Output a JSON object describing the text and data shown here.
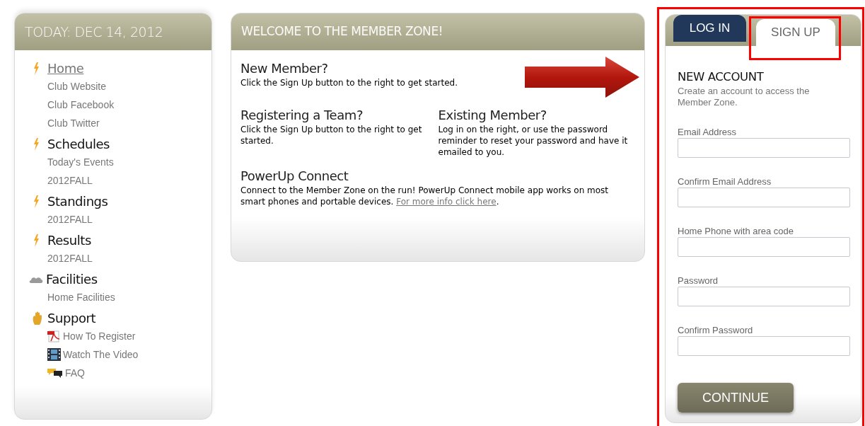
{
  "sidebar": {
    "title": "TODAY: DEC 14, 2012",
    "sections": [
      {
        "kind": "bolt",
        "label": "Home",
        "selected": true,
        "children": [
          {
            "label": "Club Website"
          },
          {
            "label": "Club Facebook"
          },
          {
            "label": "Club Twitter"
          }
        ]
      },
      {
        "kind": "bolt",
        "label": "Schedules",
        "selected": false,
        "children": [
          {
            "label": "Today's Events"
          },
          {
            "label": "2012FALL"
          }
        ]
      },
      {
        "kind": "bolt",
        "label": "Standings",
        "selected": false,
        "children": [
          {
            "label": "2012FALL"
          }
        ]
      },
      {
        "kind": "bolt",
        "label": "Results",
        "selected": false,
        "children": [
          {
            "label": "2012FALL"
          }
        ]
      },
      {
        "kind": "cloud",
        "label": "Facilities",
        "selected": false,
        "children": [
          {
            "label": "Home Facilities"
          }
        ]
      },
      {
        "kind": "hand",
        "label": "Support",
        "selected": false,
        "children": [
          {
            "label": "How To Register",
            "kind": "pdf"
          },
          {
            "label": "Watch The Video",
            "kind": "film"
          },
          {
            "label": "FAQ",
            "kind": "chat"
          }
        ]
      }
    ]
  },
  "welcome": {
    "title": "WELCOME TO THE MEMBER ZONE!",
    "new_member": {
      "heading": "New Member?",
      "text": "Click the Sign Up button to the right to get started."
    },
    "registering": {
      "heading": "Registering a Team?",
      "text": "Click the Sign Up button to the right to get started."
    },
    "existing": {
      "heading": "Existing Member?",
      "text": "Log in on the right, or use the password reminder to reset your password and have it emailed to you."
    },
    "connect": {
      "heading": "PowerUp Connect",
      "text": "Connect to the Member Zone on the run! PowerUp Connect mobile app works on most smart phones and portable devices.",
      "link": "For more info click here",
      "after": "."
    }
  },
  "account": {
    "tabs": [
      {
        "label": "LOG IN",
        "selected": false
      },
      {
        "label": "SIGN UP",
        "selected": true
      }
    ],
    "heading": "NEW ACCOUNT",
    "description": "Create an account to access the Member Zone.",
    "fields": [
      {
        "label": "Email Address"
      },
      {
        "label": "Confirm Email Address"
      },
      {
        "label": "Home Phone with area code"
      },
      {
        "label": "Password"
      },
      {
        "label": "Confirm Password"
      }
    ],
    "button": "CONTINUE"
  }
}
